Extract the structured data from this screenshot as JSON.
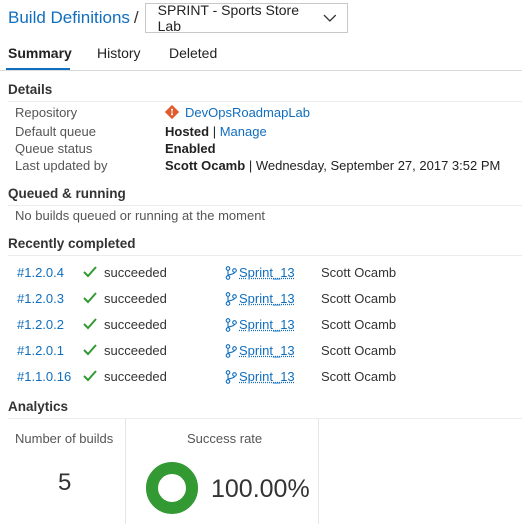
{
  "header": {
    "title": "Build Definitions",
    "separator": "/",
    "selected_definition": "SPRINT - Sports Store Lab"
  },
  "tabs": [
    {
      "label": "Summary",
      "active": true
    },
    {
      "label": "History",
      "active": false
    },
    {
      "label": "Deleted",
      "active": false
    }
  ],
  "details": {
    "heading": "Details",
    "repository_label": "Repository",
    "repository_value": "DevOpsRoadmapLab",
    "queue_label": "Default queue",
    "queue_value": "Hosted",
    "queue_divider": "|",
    "queue_link": "Manage",
    "status_label": "Queue status",
    "status_value": "Enabled",
    "updated_label": "Last updated by",
    "updated_by": "Scott Ocamb",
    "updated_divider": "|",
    "updated_date": "Wednesday, September 27, 2017 3:52 PM"
  },
  "queued": {
    "heading": "Queued & running",
    "message": "No builds queued or running at the moment"
  },
  "recent": {
    "heading": "Recently completed",
    "builds": [
      {
        "number": "#1.2.0.4",
        "status": "succeeded",
        "branch": "Sprint_13",
        "author": "Scott Ocamb"
      },
      {
        "number": "#1.2.0.3",
        "status": "succeeded",
        "branch": "Sprint_13",
        "author": "Scott Ocamb"
      },
      {
        "number": "#1.2.0.2",
        "status": "succeeded",
        "branch": "Sprint_13",
        "author": "Scott Ocamb"
      },
      {
        "number": "#1.2.0.1",
        "status": "succeeded",
        "branch": "Sprint_13",
        "author": "Scott Ocamb"
      },
      {
        "number": "#1.1.0.16",
        "status": "succeeded",
        "branch": "Sprint_13",
        "author": "Scott Ocamb"
      }
    ]
  },
  "analytics": {
    "heading": "Analytics",
    "builds_label": "Number of builds",
    "builds_value": "5",
    "success_label": "Success rate",
    "success_value": "100.00%",
    "success_fraction": 1.0
  },
  "colors": {
    "accent": "#106ebe",
    "success": "#339933",
    "repo_icon": "#e05a2b"
  },
  "icons": {
    "dropdown": "chevron-down-icon",
    "repository": "git-repo-icon",
    "status": "check-icon",
    "branch": "git-branch-icon",
    "chart": "donut-chart"
  }
}
